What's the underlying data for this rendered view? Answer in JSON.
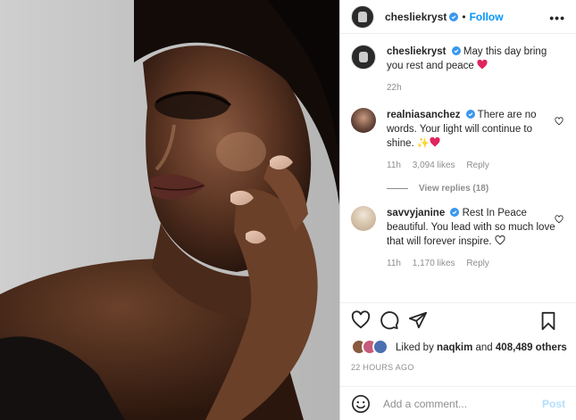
{
  "post": {
    "username": "chesliekryst",
    "follow_label": "Follow",
    "more_label": "•••",
    "dot": "•"
  },
  "caption": {
    "username": "chesliekryst",
    "text": "May this day bring you rest and peace",
    "time": "22h"
  },
  "comments": [
    {
      "username": "realniasanchez",
      "text": "There are no words. Your light will continue to shine.",
      "time": "11h",
      "likes": "3,094 likes",
      "reply_label": "Reply",
      "view_replies": "View replies (18)"
    },
    {
      "username": "savvyjanine",
      "text": "Rest In Peace beautiful. You lead with so much love that will forever inspire.",
      "time": "11h",
      "likes": "1,170 likes",
      "reply_label": "Reply"
    }
  ],
  "likes": {
    "prefix": "Liked by",
    "user": "naqkim",
    "middle": "and",
    "count": "408,489 others"
  },
  "timestamp": "22 HOURS AGO",
  "add_comment": {
    "placeholder": "Add a comment...",
    "post_label": "Post"
  },
  "icons": {
    "heart": "heart-icon",
    "comment": "comment-icon",
    "share": "share-icon",
    "bookmark": "bookmark-icon",
    "emoji": "emoji-icon",
    "verified": "verified-badge-icon"
  },
  "colors": {
    "accent": "#0095f6",
    "post_disabled": "#b2dffc",
    "red_heart": "#ed4956",
    "muted": "#8e8e8e"
  }
}
